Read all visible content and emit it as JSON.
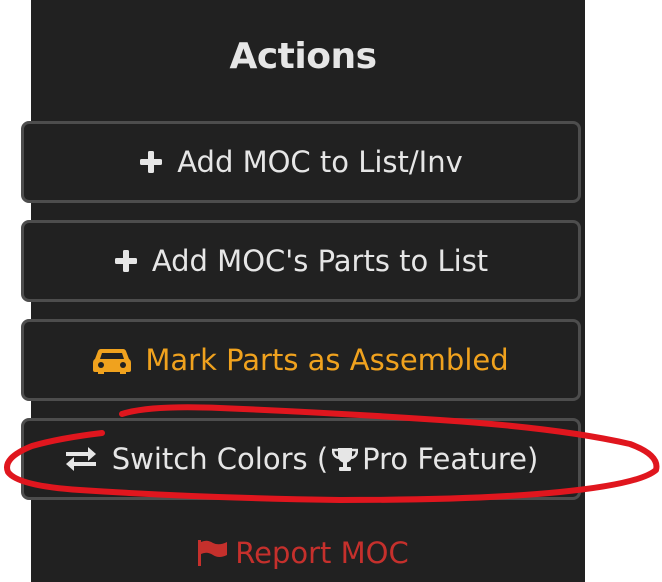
{
  "panel": {
    "title": "Actions",
    "background": "#212121"
  },
  "actions": [
    {
      "label": "Add MOC to List/Inv",
      "icon": "plus-icon"
    },
    {
      "label": "Add MOC's Parts to List",
      "icon": "plus-icon"
    },
    {
      "label": "Mark Parts as Assembled",
      "icon": "car-icon",
      "color": "#f0a21e"
    },
    {
      "label_prefix": "Switch Colors (",
      "label_suffix": " Pro Feature)",
      "icon": "swap-arrows-icon",
      "inner_icon": "trophy-icon"
    }
  ],
  "report": {
    "label": "Report MOC",
    "icon": "flag-icon",
    "color": "#c5302c"
  },
  "annotation": {
    "shape": "hand-drawn-ellipse",
    "color": "#e0161e"
  }
}
